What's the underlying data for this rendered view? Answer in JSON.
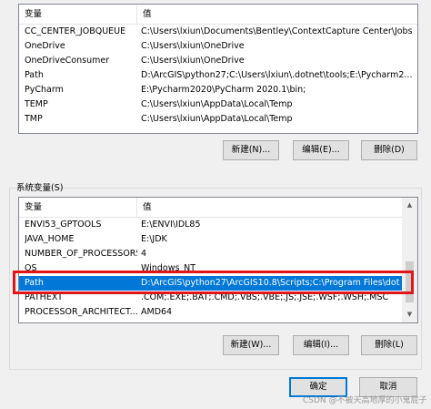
{
  "user_vars": {
    "headers": {
      "name": "变量",
      "value": "值"
    },
    "rows": [
      {
        "name": "CC_CENTER_JOBQUEUE",
        "value": "C:\\Users\\lxiun\\Documents\\Bentley\\ContextCapture Center\\Jobs"
      },
      {
        "name": "OneDrive",
        "value": "C:\\Users\\lxiun\\OneDrive"
      },
      {
        "name": "OneDriveConsumer",
        "value": "C:\\Users\\lxiun\\OneDrive"
      },
      {
        "name": "Path",
        "value": "D:\\ArcGIS\\python27;C:\\Users\\lxiun\\.dotnet\\tools;E:\\Pycharm2..."
      },
      {
        "name": "PyCharm",
        "value": "E:\\Pycharm2020\\PyCharm 2020.1\\bin;"
      },
      {
        "name": "TEMP",
        "value": "C:\\Users\\lxiun\\AppData\\Local\\Temp"
      },
      {
        "name": "TMP",
        "value": "C:\\Users\\lxiun\\AppData\\Local\\Temp"
      }
    ],
    "buttons": {
      "new": "新建(N)...",
      "edit": "编辑(E)...",
      "delete": "删除(D)"
    }
  },
  "system_vars": {
    "title": "系统变量(S)",
    "headers": {
      "name": "变量",
      "value": "值"
    },
    "rows": [
      {
        "name": "ENVI53_GPTOOLS",
        "value": "E:\\ENVI\\IDL85"
      },
      {
        "name": "JAVA_HOME",
        "value": "E:\\JDK"
      },
      {
        "name": "NUMBER_OF_PROCESSORS",
        "value": "4"
      },
      {
        "name": "OS",
        "value": "Windows_NT"
      },
      {
        "name": "Path",
        "value": "D:\\ArcGIS\\python27\\ArcGIS10.8\\Scripts;C:\\Program Files\\dot...",
        "selected": true
      },
      {
        "name": "PATHEXT",
        "value": ".COM;.EXE;.BAT;.CMD;.VBS;.VBE;.JS;.JSE;.WSF;.WSH;.MSC"
      },
      {
        "name": "PROCESSOR_ARCHITECT...",
        "value": "AMD64"
      }
    ],
    "buttons": {
      "new": "新建(W)...",
      "edit": "编辑(I)...",
      "delete": "删除(L)"
    }
  },
  "dialog_buttons": {
    "ok": "确定",
    "cancel": "取消"
  },
  "watermark": "CSDN @不被天高地厚的小鬼屁子",
  "colors": {
    "selection": "#0078d7",
    "highlight_box": "#e0161a"
  }
}
